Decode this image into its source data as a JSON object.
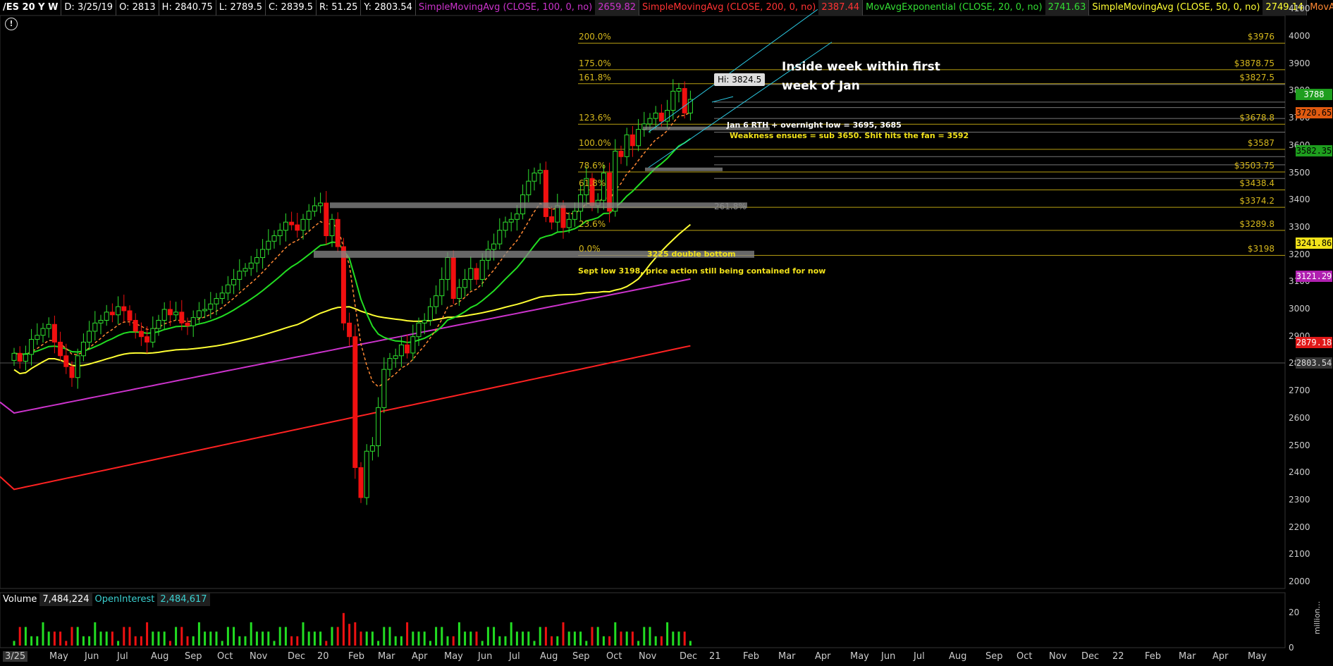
{
  "header": {
    "symbol": "/ES 20 Y W",
    "d": "D: 3/25/19",
    "o": "O: 2813",
    "h": "H: 2840.75",
    "l": "L: 2789.5",
    "c": "C: 2839.5",
    "r": "R: 51.25",
    "y": "Y: 2803.54",
    "studies": [
      {
        "label": "SimpleMovingAvg (CLOSE, 100, 0, no)",
        "value": "2659.82",
        "color": "#cc33cc"
      },
      {
        "label": "SimpleMovingAvg (CLOSE, 200, 0, no)",
        "value": "2387.44",
        "color": "#ff3333"
      },
      {
        "label": "MovAvgExponential (CLOSE, 20, 0, no)",
        "value": "2741.63",
        "color": "#33dd33"
      },
      {
        "label": "SimpleMovingAvg (CLOSE, 50, 0, no)",
        "value": "2749.14",
        "color": "#ffff33"
      },
      {
        "label": "MovAvgExponential (CLOSE,...",
        "value": "",
        "color": "#ff8833"
      }
    ]
  },
  "chart_data": {
    "type": "candlestick",
    "y_range": [
      2000,
      4100
    ],
    "yticks": [
      "4100",
      "4000",
      "3900",
      "3800",
      "3700",
      "3600",
      "3500",
      "3400",
      "3300",
      "3200",
      "3100",
      "3000",
      "2900",
      "2800",
      "2700",
      "2600",
      "2500",
      "2400",
      "2300",
      "2200",
      "2100",
      "2000"
    ],
    "xticks": [
      "3/25",
      "May",
      "Jun",
      "Jul",
      "Aug",
      "Sep",
      "Oct",
      "Nov",
      "Dec",
      "20",
      "Feb",
      "Mar",
      "Apr",
      "May",
      "Jun",
      "Jul",
      "Aug",
      "Sep",
      "Oct",
      "Nov",
      "Dec",
      "21",
      "Feb",
      "Mar",
      "Apr",
      "May",
      "Jun",
      "Jul",
      "Aug",
      "Sep",
      "Oct",
      "Nov",
      "Dec",
      "22",
      "Feb",
      "Mar",
      "Apr",
      "May"
    ],
    "weekly_closes": [
      2839,
      2810,
      2835,
      2890,
      2905,
      2930,
      2945,
      2880,
      2830,
      2790,
      2750,
      2830,
      2880,
      2920,
      2950,
      2960,
      2990,
      2980,
      3010,
      2995,
      2960,
      2920,
      2900,
      2880,
      2930,
      2960,
      3000,
      2980,
      2990,
      2950,
      2940,
      2970,
      2995,
      3000,
      3020,
      3040,
      3060,
      3090,
      3110,
      3140,
      3150,
      3170,
      3190,
      3220,
      3250,
      3270,
      3290,
      3320,
      3310,
      3290,
      3330,
      3360,
      3380,
      3390,
      3270,
      3330,
      3230,
      2950,
      2900,
      2420,
      2310,
      2480,
      2500,
      2640,
      2780,
      2820,
      2830,
      2870,
      2840,
      2900,
      2950,
      2960,
      3010,
      3050,
      3110,
      3190,
      3040,
      3080,
      3110,
      3150,
      3110,
      3180,
      3220,
      3240,
      3290,
      3320,
      3330,
      3350,
      3420,
      3470,
      3500,
      3510,
      3340,
      3320,
      3380,
      3300,
      3330,
      3360,
      3420,
      3480,
      3380,
      3400,
      3500,
      3360,
      3580,
      3560,
      3640,
      3600,
      3660,
      3680,
      3700,
      3720,
      3690,
      3730,
      3800,
      3810,
      3720,
      3770
    ],
    "moving_averages": [
      {
        "name": "SimpleMovingAvg (CLOSE, 100, 0, no)",
        "color": "#cc33cc",
        "last": 3121.29
      },
      {
        "name": "SimpleMovingAvg (CLOSE, 200, 0, no)",
        "color": "#ff3333",
        "last": 2879.18
      },
      {
        "name": "MovAvgExponential (CLOSE, 20, 0, no)",
        "color": "#33dd33",
        "last": 3582.35
      },
      {
        "name": "SimpleMovingAvg (CLOSE, 50, 0, no)",
        "color": "#ffff33",
        "last": 3241.86
      }
    ],
    "fib_levels": [
      {
        "label": "200.0%",
        "price": 3976,
        "price_label": "$3976"
      },
      {
        "label": "175.0%",
        "price": 3878.75,
        "price_label": "$3878.75"
      },
      {
        "label": "161.8%",
        "price": 3827.5,
        "price_label": "$3827.5"
      },
      {
        "label": "123.6%",
        "price": 3678.8,
        "price_label": "$3678.8"
      },
      {
        "label": "100.0%",
        "price": 3587,
        "price_label": "$3587"
      },
      {
        "label": "78.6%",
        "price": 3503.75,
        "price_label": "$3503.75"
      },
      {
        "label": "61.8%",
        "price": 3438.4,
        "price_label": "$3438.4"
      },
      {
        "label": "",
        "price": 3374.2,
        "price_label": "$3374.2"
      },
      {
        "label": "23.6%",
        "price": 3289.8,
        "price_label": "$3289.8"
      },
      {
        "label": "0.0%",
        "price": 3198,
        "price_label": "$3198"
      }
    ],
    "price_badges": [
      {
        "value": "3788",
        "bg": "#1e9e1e",
        "fg": "#ffffff",
        "price": 3788
      },
      {
        "value": "3720.65",
        "bg": "#e05a10",
        "fg": "#000000",
        "price": 3720.65
      },
      {
        "value": "3582.35",
        "bg": "#1e9e1e",
        "fg": "#000000",
        "price": 3582.35
      },
      {
        "value": "3241.86",
        "bg": "#f2e21a",
        "fg": "#000000",
        "price": 3241.86
      },
      {
        "value": "3121.29",
        "bg": "#b020b0",
        "fg": "#ffffff",
        "price": 3121.29
      },
      {
        "value": "2879.18",
        "bg": "#e01818",
        "fg": "#ffffff",
        "price": 2879.18
      },
      {
        "value": "2803.54",
        "bg": "#333333",
        "fg": "#dddddd",
        "price": 2803.54
      }
    ],
    "annotations": {
      "hi_label": "Hi: 3824.5",
      "inside_week": "Inside week within first",
      "inside_week_2": "week of Jan",
      "jan6": "Jan 6  RTH + overnight low = 3695, 3685",
      "weakness": "Weakness ensues = sub 3650. Shit hits the fan = 3592",
      "fib_2618": "261.8%",
      "double_bottom": "3225 double bottom",
      "sept_low": "Sept low 3198, price action still being contained for now"
    },
    "volume": {
      "label": "Volume",
      "value": "7,484,224",
      "oi_label": "OpenInterest",
      "oi_value": "2,484,617",
      "ticks": [
        "20",
        "0"
      ],
      "unit_label": "million..."
    }
  }
}
